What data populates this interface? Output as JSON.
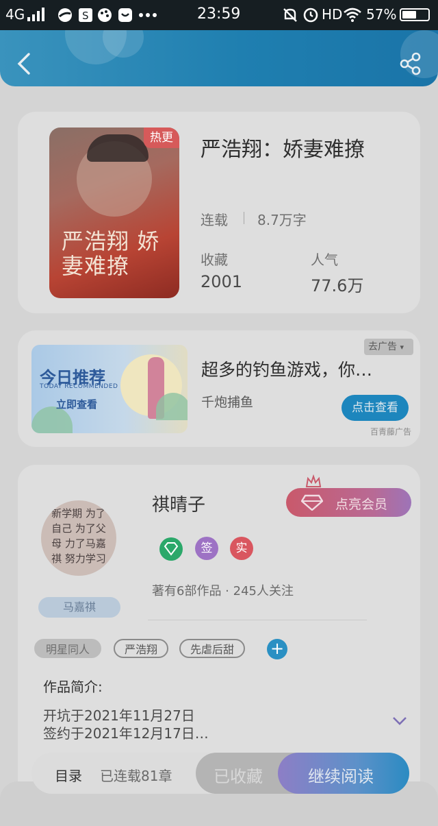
{
  "status_bar": {
    "network": "4G",
    "time": "23:59",
    "hd": "HD",
    "battery": "57%"
  },
  "book": {
    "badge": "热更",
    "title": "严浩翔：娇妻难撩",
    "status": "连载",
    "word_count": "8.7万字",
    "collect_label": "收藏",
    "collect_value": "2001",
    "popularity_label": "人气",
    "popularity_value": "77.6万",
    "cover_title": "严浩翔 娇妻难撩"
  },
  "ad": {
    "image_title": "今日推荐",
    "image_subtitle": "TODAY RECOMMENDED",
    "image_button": "立即查看",
    "remove_label": "去广告",
    "title": "超多的钓鱼游戏，你…",
    "subtitle": "千炮捕鱼",
    "cta": "点击查看",
    "source": "百青藤广告"
  },
  "author": {
    "name": "祺晴子",
    "avatar_tag": "马嘉祺",
    "avatar_chars": "新学期 为了自己 为了父母 力了马嘉祺 努力学习",
    "badge_sign": "签",
    "badge_real": "实",
    "stats": "著有6部作品 · 245人关注",
    "vip_button": "点亮会员"
  },
  "tags": [
    "明星同人",
    "严浩翔",
    "先虐后甜"
  ],
  "intro": {
    "label": "作品简介:",
    "line1": "开坑于2021年11月27日",
    "line2": "签约于2021年12月17日…"
  },
  "bottom_bar": {
    "catalog": "目录",
    "chapters": "已连载81章",
    "collected": "已收藏",
    "continue": "继续阅读"
  },
  "colors": {
    "header_gradient_start": "#3a93bd",
    "header_gradient_end": "#1a74a8",
    "accent_blue": "#1d86bd",
    "vip_red": "#c95a6b",
    "continue_purple": "#8a7dc7"
  }
}
